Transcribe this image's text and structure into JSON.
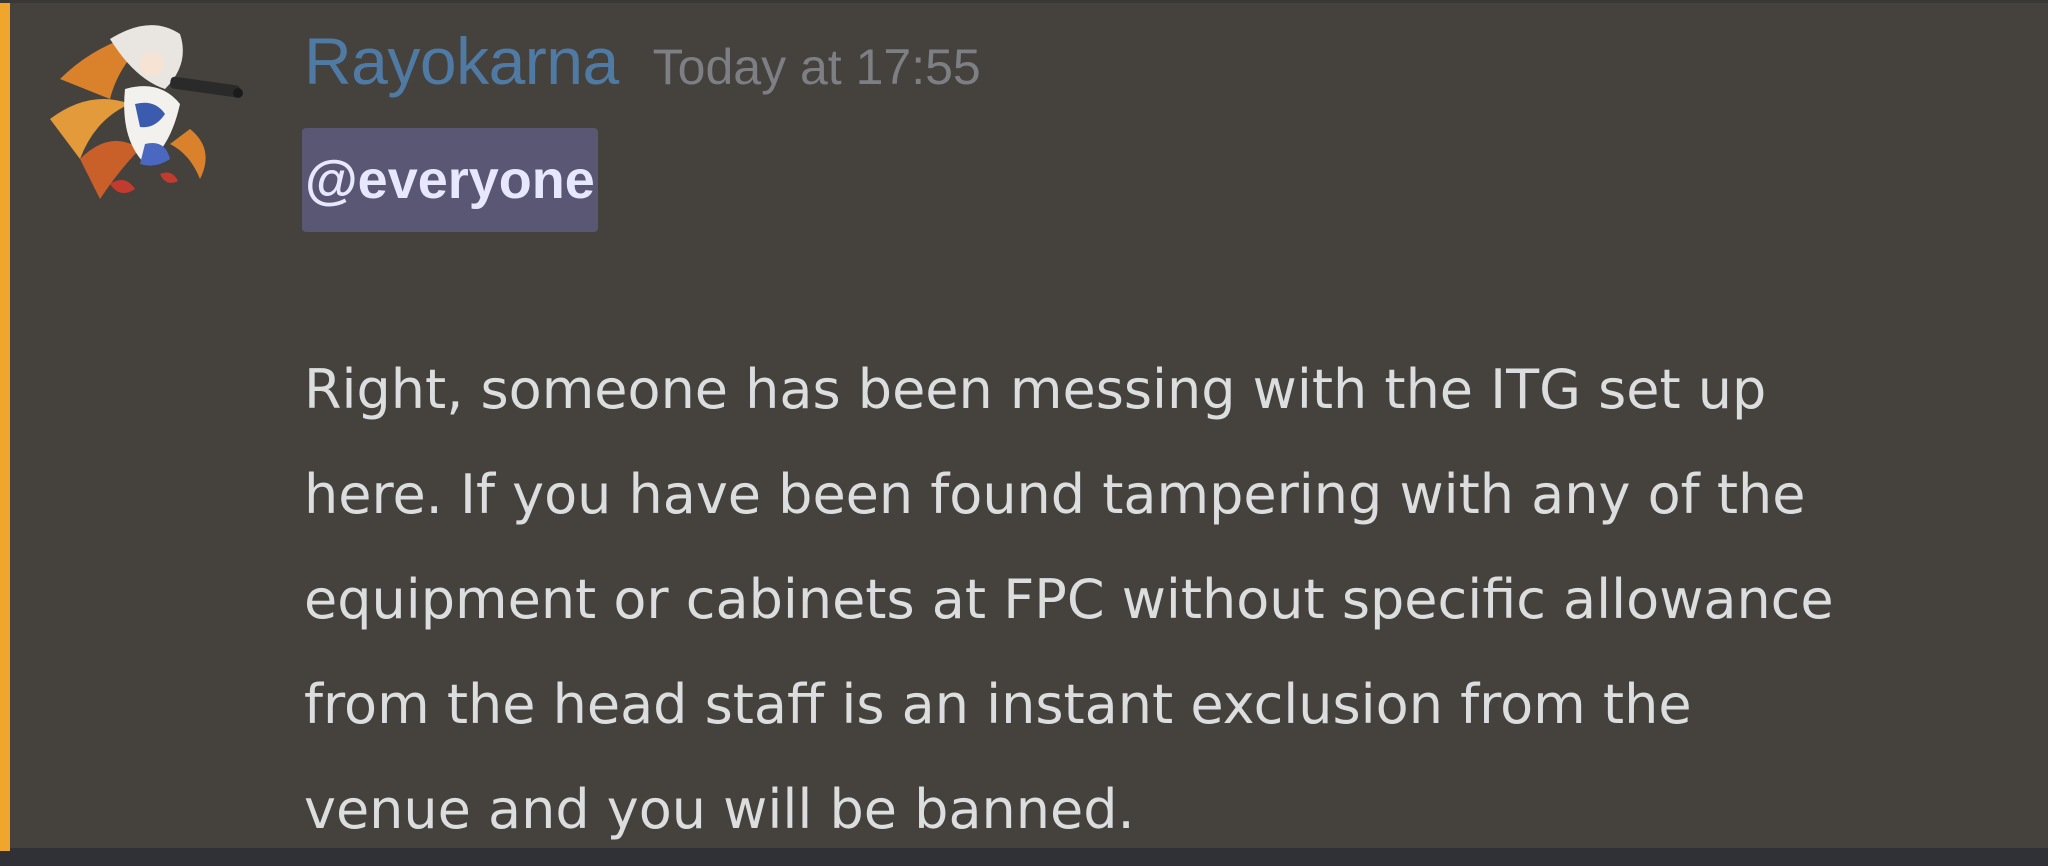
{
  "message": {
    "author": "Rayokarna",
    "timestamp": "Today at 17:55",
    "mention": "@everyone",
    "body_lines": [
      "Right, someone has been messing with the ITG set up",
      "here. If you have been found tampering with any of the",
      "equipment or cabinets at FPC without specific allowance",
      "from the head staff is an instant exclusion from the",
      "venue and you will be banned."
    ]
  },
  "colors": {
    "background": "#45423d",
    "accent_bar": "#f0a52c",
    "username": "#4f7aa4",
    "timestamp": "#7d7f84",
    "mention_bg": "#5a5775",
    "text": "#dcddde"
  },
  "icons": {
    "avatar": "avatar-anime-character"
  }
}
